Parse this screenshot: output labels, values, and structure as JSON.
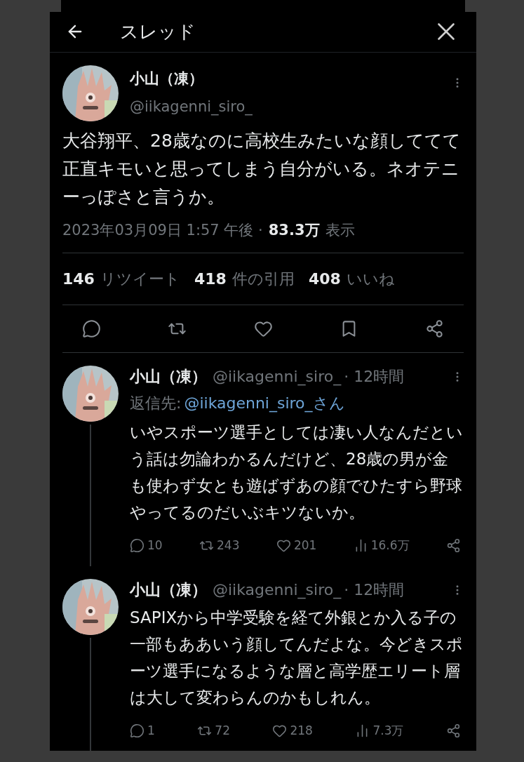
{
  "header": {
    "title": "スレッド"
  },
  "main_tweet": {
    "name": "小山（凍）",
    "handle": "@iikagenni_siro_",
    "text": "大谷翔平、28歳なのに高校生みたいな顔しててて正直キモいと思ってしまう自分がいる。ネオテニーっぽさと言うか。",
    "timestamp": "2023年03月09日 1:57 午後 ·",
    "views_count": "83.3万",
    "views_label": "表示",
    "stats": [
      {
        "count": "146",
        "label": "リツイート"
      },
      {
        "count": "418",
        "label": "件の引用"
      },
      {
        "count": "408",
        "label": "いいね"
      }
    ],
    "actions": [
      {
        "kind": "reply"
      },
      {
        "kind": "retweet"
      },
      {
        "kind": "like"
      },
      {
        "kind": "bookmark"
      },
      {
        "kind": "share"
      }
    ]
  },
  "replies": [
    {
      "name": "小山（凍）",
      "handle": "@iikagenni_siro_",
      "time": "· 12時間",
      "reply_to_label": "返信先:",
      "reply_to": "@iikagenni_siro_さん",
      "text": "いやスポーツ選手としては凄い人なんだという話は勿論わかるんだけど、28歳の男が金も使わず女とも遊ばずあの顔でひたすら野球やってるのだいぶキツないか。",
      "replies": "10",
      "retweets": "243",
      "likes": "201",
      "views": "16.6万",
      "thread_line": true
    },
    {
      "name": "小山（凍）",
      "handle": "@iikagenni_siro_",
      "time": "· 12時間",
      "text": "SAPIXから中学受験を経て外銀とか入る子の一部もああいう顔してんだよな。今どきスポーツ選手になるような層と高学歴エリート層は大して変わらんのかもしれん。",
      "replies": "1",
      "retweets": "72",
      "likes": "218",
      "views": "7.3万",
      "thread_line": true
    }
  ]
}
